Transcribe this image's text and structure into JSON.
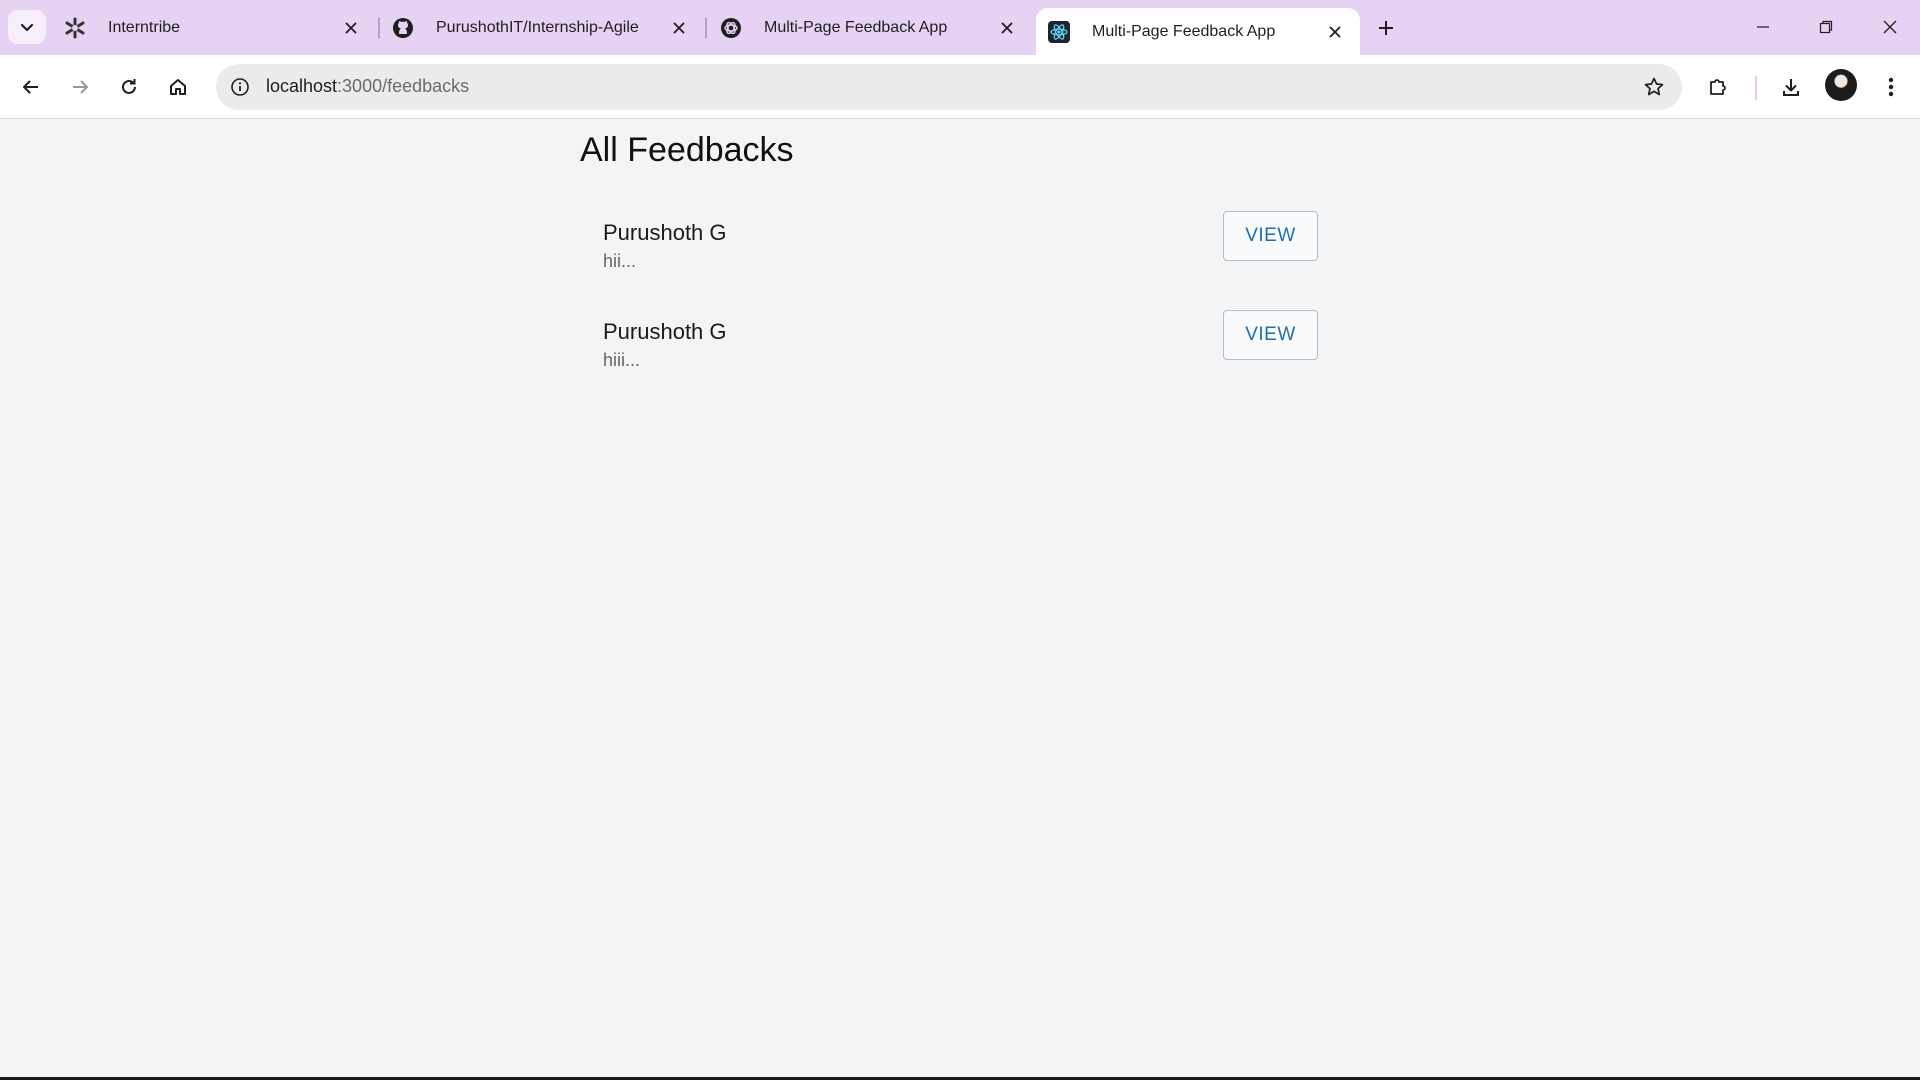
{
  "browser": {
    "tabs": [
      {
        "title": "Interntribe",
        "icon": "interntribe-logo-icon",
        "active": false
      },
      {
        "title": "PurushothIT/Internship-Agile",
        "icon": "github-icon",
        "active": false
      },
      {
        "title": "Multi-Page Feedback App",
        "icon": "openai-icon",
        "active": false
      },
      {
        "title": "Multi-Page Feedback App",
        "icon": "react-icon",
        "active": true
      }
    ],
    "address": {
      "host": "localhost",
      "path": ":3000/feedbacks"
    }
  },
  "page": {
    "title": "All Feedbacks",
    "feedbacks": [
      {
        "name": "Purushoth G",
        "excerpt": "hii...",
        "button": "VIEW"
      },
      {
        "name": "Purushoth G",
        "excerpt": "hiii...",
        "button": "VIEW"
      }
    ]
  },
  "colors": {
    "tabstrip": "#e6d2f3",
    "button_text": "#1e6fb0",
    "page_bg": "#f4f4f4"
  }
}
